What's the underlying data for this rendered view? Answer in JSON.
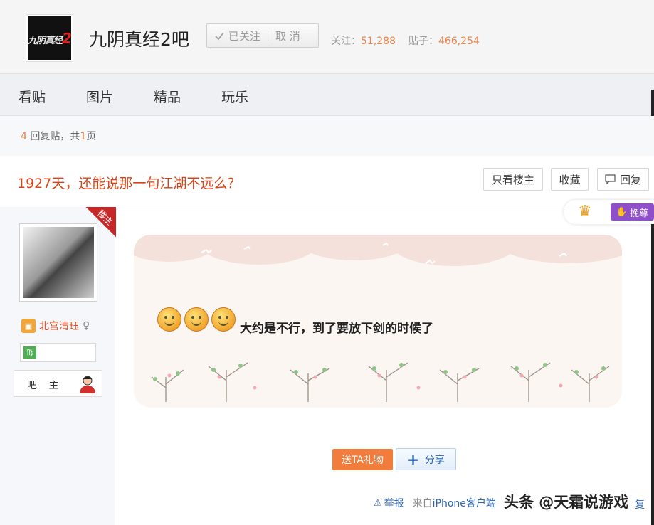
{
  "forum": {
    "name": "九阴真经2吧",
    "logo_text": "九阴真经",
    "logo_num": "2",
    "follow_label": "已关注",
    "unfollow_label": "取 消",
    "followers_label": "关注：",
    "followers": "51,288",
    "posts_label": "贴子：",
    "posts": "466,254"
  },
  "nav": {
    "items": [
      "看贴",
      "图片",
      "精品",
      "玩乐"
    ]
  },
  "thread": {
    "reply_count": "4",
    "reply_label_a": "回复贴，共",
    "page_count": "1",
    "reply_label_b": "页",
    "title": "1927天，还能说那一句江湖不远么？",
    "only_op_label": "只看楼主",
    "favorite_label": "收藏",
    "reply_label": "回复"
  },
  "author": {
    "op_tag": "楼主",
    "name": "北宫清珏",
    "role": "吧 主",
    "zodiac": "♍"
  },
  "badge": {
    "pull_label": "挽尊"
  },
  "post": {
    "text": "大约是不行，到了要放下剑的时候了",
    "gift_label": "送TA礼物",
    "share_label": "分享",
    "report_label": "举报",
    "client_prefix": "来自",
    "client_link": "iPhone客户端",
    "reply_tail": "复"
  },
  "watermark": "头条 @天霜说游戏",
  "colors": {
    "accent_orange": "#e8834a",
    "title_red": "#d84315",
    "link_blue": "#2d64b3"
  }
}
